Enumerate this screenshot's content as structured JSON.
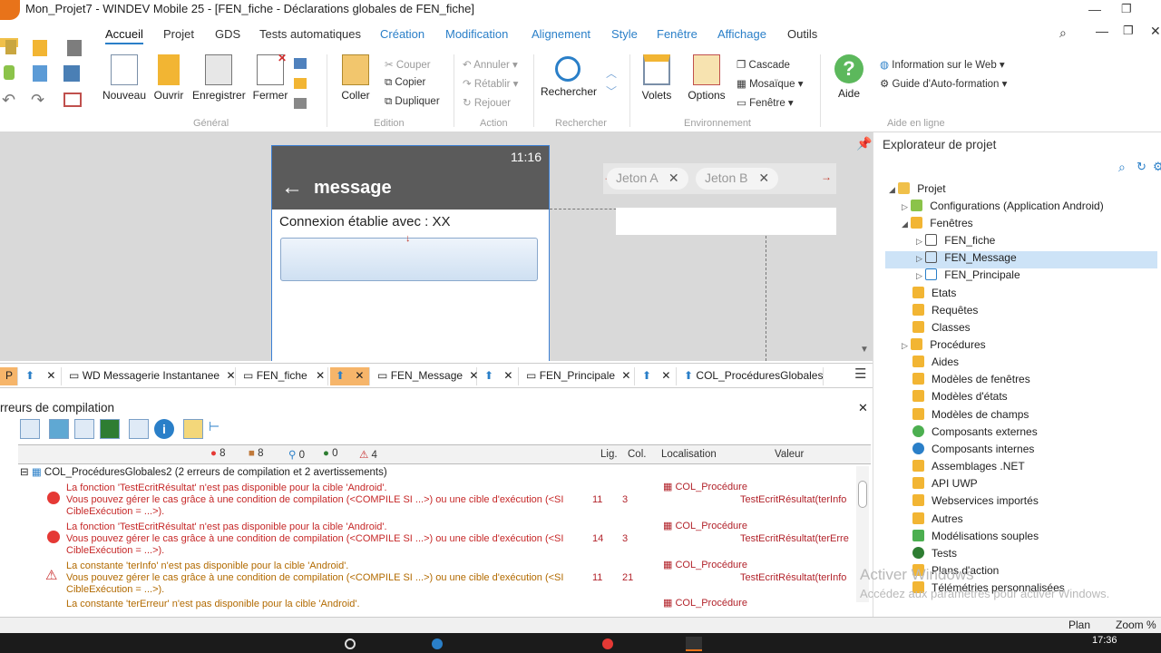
{
  "window": {
    "title": "Mon_Projet7 - WINDEV Mobile 25 - [FEN_fiche - Déclarations globales de FEN_fiche]"
  },
  "menu": {
    "tabs": [
      "Accueil",
      "Projet",
      "GDS",
      "Tests automatiques",
      "Création",
      "Modification",
      "Alignement",
      "Style",
      "Fenêtre",
      "Affichage",
      "Outils"
    ]
  },
  "ribbon": {
    "general": {
      "nouveau": "Nouveau",
      "ouvrir": "Ouvrir",
      "enregistrer": "Enregistrer",
      "fermer": "Fermer",
      "label": "Général"
    },
    "edition": {
      "coller": "Coller",
      "couper": "Couper",
      "copier": "Copier",
      "dupliquer": "Dupliquer",
      "label": "Edition"
    },
    "action": {
      "annuler": "Annuler",
      "retablir": "Rétablir",
      "rejouer": "Rejouer",
      "label": "Action"
    },
    "rechercher": {
      "rechercher": "Rechercher",
      "label": "Rechercher"
    },
    "environnement": {
      "volets": "Volets",
      "options": "Options",
      "cascade": "Cascade",
      "mosaique": "Mosaïque",
      "fenetre": "Fenêtre",
      "label": "Environnement"
    },
    "aide": {
      "aide": "Aide",
      "info_web": "Information sur le Web",
      "guide": "Guide d'Auto-formation",
      "label": "Aide en ligne"
    }
  },
  "phone": {
    "time": "11:16",
    "title": "message",
    "connexion": "Connexion établie avec : XX"
  },
  "jetons": [
    "Jeton A",
    "Jeton B"
  ],
  "doc_tabs": [
    {
      "label": ""
    },
    {
      "label": "WD Messagerie Instantanee"
    },
    {
      "label": "FEN_fiche"
    },
    {
      "label": ""
    },
    {
      "label": "FEN_Message"
    },
    {
      "label": ""
    },
    {
      "label": "FEN_Principale"
    },
    {
      "label": ""
    },
    {
      "label": "COL_ProcéduresGlobales"
    }
  ],
  "errors": {
    "pane_title": "rreurs de compilation",
    "counts": {
      "errors": "8",
      "info": "8",
      "hints": "0",
      "green": "0",
      "warnings": "4"
    },
    "columns": {
      "lig": "Lig.",
      "col": "Col.",
      "loc": "Localisation",
      "val": "Valeur"
    },
    "group": "COL_ProcéduresGlobales2 (2 erreurs de compilation et 2 avertissements)",
    "rows": [
      {
        "l1": "La fonction 'TestEcritRésultat' n'est pas disponible pour la cible 'Android'.",
        "l2": "Vous pouvez gérer le cas grâce à une condition de compilation (<COMPILE SI ...>) ou une cible d'exécution (<SI",
        "l3": "CibleExécution = ...>).",
        "lig": "11",
        "col": "3",
        "loc": "COL_Procédure",
        "val": "TestEcritRésultat(terInfo"
      },
      {
        "l1": "La fonction 'TestEcritRésultat' n'est pas disponible pour la cible 'Android'.",
        "l2": "Vous pouvez gérer le cas grâce à une condition de compilation (<COMPILE SI ...>) ou une cible d'exécution (<SI",
        "l3": "CibleExécution = ...>).",
        "lig": "14",
        "col": "3",
        "loc": "COL_Procédure",
        "val": "TestEcritRésultat(terErre"
      },
      {
        "l1": "La constante 'terInfo' n'est pas disponible pour la cible 'Android'.",
        "l2": "Vous pouvez gérer le cas grâce à une condition de compilation (<COMPILE SI ...>) ou une cible d'exécution (<SI",
        "l3": "CibleExécution = ...>).",
        "lig": "11",
        "col": "21",
        "loc": "COL_Procédure",
        "val": "TestEcritRésultat(terInfo"
      },
      {
        "l1": "La constante 'terErreur' n'est pas disponible pour la cible 'Android'.",
        "l2": "",
        "l3": "",
        "lig": "",
        "col": "",
        "loc": "COL_Procédure",
        "val": ""
      }
    ]
  },
  "explorer": {
    "title": "Explorateur de projet",
    "items": [
      "Projet",
      "Configurations (Application Android)",
      "Fenêtres",
      "FEN_fiche",
      "FEN_Message",
      "FEN_Principale",
      "Etats",
      "Requêtes",
      "Classes",
      "Procédures",
      "Aides",
      "Modèles de fenêtres",
      "Modèles d'états",
      "Modèles de champs",
      "Composants externes",
      "Composants internes",
      "Assemblages .NET",
      "API UWP",
      "Webservices importés",
      "Autres",
      "Modélisations souples",
      "Tests",
      "Plans d'action",
      "Télémétries personnalisées"
    ],
    "watermark1": "Activer Windows",
    "watermark2": "Accédez aux paramètres pour activer Windows."
  },
  "statusbar": {
    "plan": "Plan",
    "zoom": "Zoom %"
  },
  "colors": {
    "accent": "#2a7fc8",
    "selected_tab": "#f6b56a",
    "phone_bar": "#5b5b5b",
    "error": "#c62828",
    "warning": "#b26a00"
  }
}
